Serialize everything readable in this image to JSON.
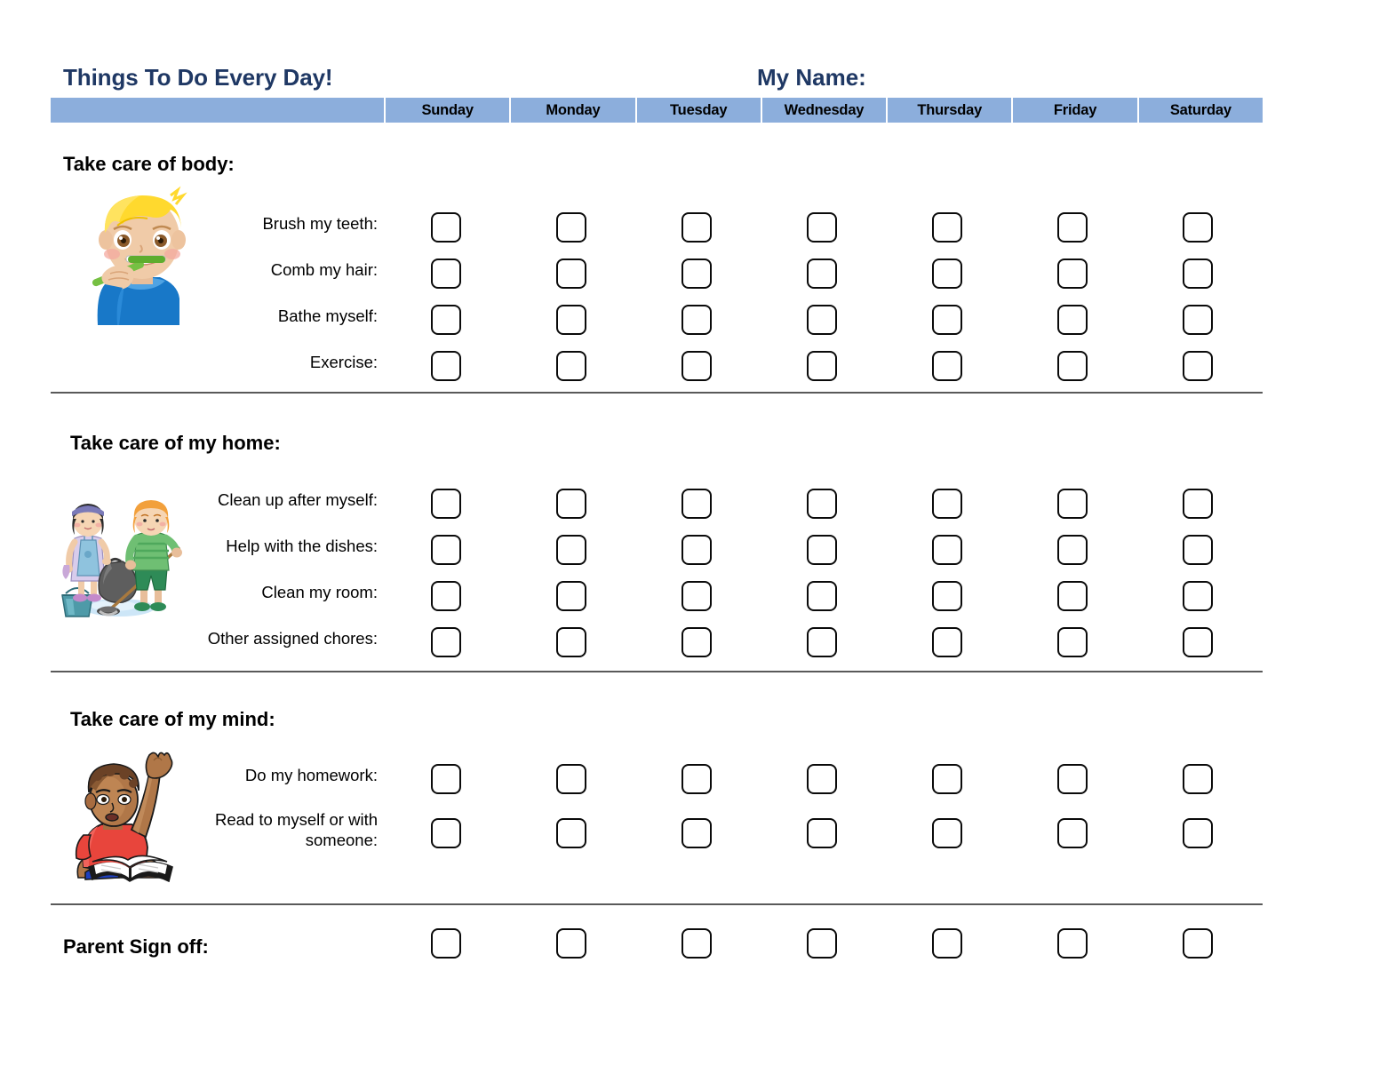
{
  "header": {
    "title": "Things To Do Every Day!",
    "name_label": "My Name:",
    "days": [
      "Sunday",
      "Monday",
      "Tuesday",
      "Wednesday",
      "Thursday",
      "Friday",
      "Saturday"
    ]
  },
  "sections": [
    {
      "title": "Take care of body:",
      "illustration": "boy-brushing-teeth-icon",
      "items": [
        {
          "label": "Brush my teeth:"
        },
        {
          "label": "Comb my hair:"
        },
        {
          "label": "Bathe myself:"
        },
        {
          "label": "Exercise:"
        }
      ]
    },
    {
      "title": "Take care of my home:",
      "illustration": "children-cleaning-icon",
      "items": [
        {
          "label": "Clean up after myself:"
        },
        {
          "label": "Help with the dishes:"
        },
        {
          "label": "Clean my room:"
        },
        {
          "label": "Other assigned chores:"
        }
      ]
    },
    {
      "title": "Take care of my mind:",
      "illustration": "boy-reading-book-icon",
      "items": [
        {
          "label": "Do my homework:"
        },
        {
          "label": "Read to myself or with someone:"
        }
      ]
    }
  ],
  "footer": {
    "label": "Parent Sign off:"
  },
  "colors": {
    "header_band": "#8CAEDC",
    "title_text": "#1F3864",
    "divider": "#595959",
    "checkbox_border": "#0A0A0A"
  }
}
